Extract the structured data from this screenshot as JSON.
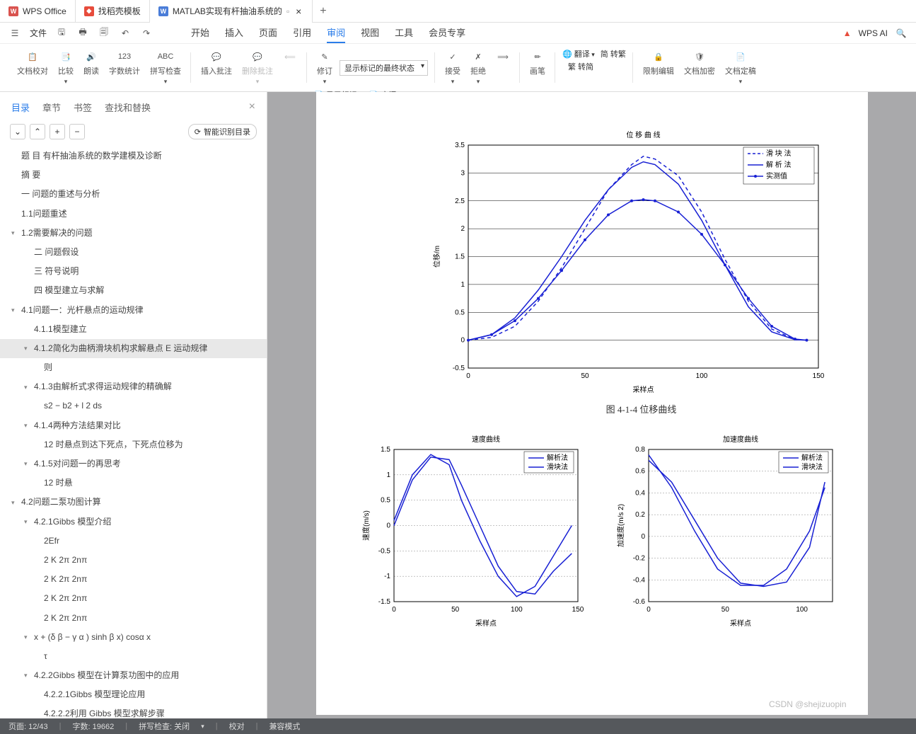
{
  "titlebar": {
    "tabs": [
      {
        "label": "WPS Office",
        "logo_bg": "#d9534f",
        "logo_text": "W"
      },
      {
        "label": "找稻壳模板",
        "logo_bg": "#e74c3c",
        "logo_text": "◆"
      },
      {
        "label": "MATLAB实现有杆抽油系统的",
        "logo_bg": "#4a7dd8",
        "logo_text": "W",
        "active": true,
        "suffix_icon": "▫"
      }
    ]
  },
  "menubar": {
    "file_label": "文件",
    "tabs": [
      "开始",
      "插入",
      "页面",
      "引用",
      "审阅",
      "视图",
      "工具",
      "会员专享"
    ],
    "active_tab": "审阅",
    "wps_ai": "WPS AI"
  },
  "ribbon": {
    "g1": {
      "b1": "文档校对",
      "b2": "比较",
      "b3": "朗读",
      "b4": "字数统计",
      "b5": "拼写检查"
    },
    "g2": {
      "b1": "插入批注",
      "b2": "删除批注"
    },
    "g3": {
      "b1": "修订",
      "sel": "显示标记的最终状态",
      "b2": "显示标记",
      "b3": "审阅"
    },
    "g4": {
      "b1": "接受",
      "b2": "拒绝"
    },
    "g5": {
      "b1": "画笔"
    },
    "g6": {
      "b1": "翻译",
      "b2": "简  转繁",
      "b3": "繁  转简"
    },
    "g7": {
      "b1": "限制编辑",
      "b2": "文档加密",
      "b3": "文档定稿"
    }
  },
  "sidebar": {
    "tabs": [
      "目录",
      "章节",
      "书签",
      "查找和替换"
    ],
    "active": "目录",
    "ai_btn": "智能识别目录",
    "toc": [
      {
        "lvl": 0,
        "txt": "题 目 有杆抽油系统的数学建模及诊断"
      },
      {
        "lvl": 0,
        "txt": "摘 要"
      },
      {
        "lvl": 0,
        "txt": "一 问题的重述与分析"
      },
      {
        "lvl": 0,
        "txt": "1.1问题重述"
      },
      {
        "lvl": 0,
        "txt": "1.2需要解决的问题",
        "caret": "▾"
      },
      {
        "lvl": 2,
        "txt": "二 问题假设"
      },
      {
        "lvl": 2,
        "txt": "三 符号说明"
      },
      {
        "lvl": 2,
        "txt": "四 模型建立与求解"
      },
      {
        "lvl": 0,
        "txt": "4.1问题一：光杆悬点的运动规律",
        "caret": "▾"
      },
      {
        "lvl": 2,
        "txt": "4.1.1模型建立"
      },
      {
        "lvl": 2,
        "txt": "4.1.2简化为曲柄滑块机构求解悬点 E 运动规律",
        "caret": "▾",
        "sel": true
      },
      {
        "lvl": 3,
        "txt": "则"
      },
      {
        "lvl": 2,
        "txt": "4.1.3由解析式求得运动规律的精确解",
        "caret": "▾"
      },
      {
        "lvl": 3,
        "txt": "s2 − b2 + l 2 ds"
      },
      {
        "lvl": 2,
        "txt": "4.1.4两种方法结果对比",
        "caret": "▾"
      },
      {
        "lvl": 3,
        "txt": "12 时悬点到达下死点，下死点位移为"
      },
      {
        "lvl": 2,
        "txt": "4.1.5对问题一的再思考",
        "caret": "▾"
      },
      {
        "lvl": 3,
        "txt": "12 时悬"
      },
      {
        "lvl": 0,
        "txt": "4.2问题二泵功图计算",
        "caret": "▾"
      },
      {
        "lvl": 2,
        "txt": "4.2.1Gibbs 模型介绍",
        "caret": "▾"
      },
      {
        "lvl": 3,
        "txt": "2Efr"
      },
      {
        "lvl": 3,
        "txt": "2  K  2π  2nπ"
      },
      {
        "lvl": 3,
        "txt": "2  K  2π  2nπ"
      },
      {
        "lvl": 3,
        "txt": "2  K  2π  2nπ"
      },
      {
        "lvl": 3,
        "txt": "2  K  2π  2nπ"
      },
      {
        "lvl": 2,
        "txt": "x + (δ β − γ α )  sinh β x)  cosα x",
        "caret": "▾"
      },
      {
        "lvl": 3,
        "txt": "τ"
      },
      {
        "lvl": 2,
        "txt": "4.2.2Gibbs 模型在计算泵功图中的应用",
        "caret": "▾"
      },
      {
        "lvl": 3,
        "txt": "4.2.2.1Gibbs 模型理论应用"
      },
      {
        "lvl": 3,
        "txt": "4.2.2.2利用 Gibbs 模型求解步骤"
      }
    ]
  },
  "document": {
    "fig_caption": "图 4-1-4    位移曲线",
    "watermark": "CSDN @shejizuopin"
  },
  "chart_data": [
    {
      "type": "line",
      "title": "位 移 曲 线",
      "xlabel": "采样点",
      "ylabel": "位移/m",
      "xlim": [
        0,
        150
      ],
      "ylim": [
        -0.5,
        3.5
      ],
      "xticks": [
        0,
        50,
        100,
        150
      ],
      "yticks": [
        -0.5,
        0,
        0.5,
        1,
        1.5,
        2,
        2.5,
        3,
        3.5
      ],
      "series": [
        {
          "name": "滑 块 法",
          "style": "dashed",
          "color": "#1820d4",
          "x": [
            0,
            10,
            20,
            30,
            40,
            50,
            60,
            70,
            75,
            80,
            90,
            100,
            110,
            120,
            130,
            140,
            145
          ],
          "y": [
            0,
            0.05,
            0.25,
            0.7,
            1.3,
            2.0,
            2.7,
            3.15,
            3.3,
            3.25,
            2.95,
            2.3,
            1.45,
            0.7,
            0.2,
            0.01,
            0
          ]
        },
        {
          "name": "解 析 法",
          "style": "solid",
          "color": "#1820d4",
          "x": [
            0,
            10,
            20,
            30,
            40,
            50,
            60,
            70,
            75,
            80,
            90,
            100,
            110,
            120,
            130,
            140,
            145
          ],
          "y": [
            0,
            0.1,
            0.4,
            0.9,
            1.5,
            2.15,
            2.7,
            3.1,
            3.2,
            3.15,
            2.8,
            2.15,
            1.35,
            0.6,
            0.15,
            0.01,
            0
          ]
        },
        {
          "name": "实测值",
          "style": "points",
          "color": "#1820d4",
          "x": [
            0,
            10,
            20,
            30,
            40,
            50,
            60,
            70,
            75,
            80,
            90,
            100,
            110,
            120,
            130,
            140,
            145
          ],
          "y": [
            0,
            0.1,
            0.35,
            0.75,
            1.25,
            1.8,
            2.25,
            2.5,
            2.52,
            2.5,
            2.3,
            1.9,
            1.35,
            0.75,
            0.25,
            0.02,
            0
          ]
        }
      ]
    },
    {
      "type": "line",
      "title": "速度曲线",
      "xlabel": "采样点",
      "ylabel": "速度(m/s)",
      "xlim": [
        0,
        150
      ],
      "ylim": [
        -1.5,
        1.5
      ],
      "xticks": [
        0,
        50,
        100,
        150
      ],
      "yticks": [
        -1.5,
        -1,
        -0.5,
        0,
        0.5,
        1,
        1.5
      ],
      "series": [
        {
          "name": "解析法",
          "style": "solid",
          "color": "#1820d4",
          "x": [
            0,
            15,
            30,
            45,
            55,
            70,
            85,
            100,
            115,
            130,
            145
          ],
          "y": [
            0,
            0.9,
            1.35,
            1.3,
            0.8,
            0,
            -0.8,
            -1.3,
            -1.35,
            -0.9,
            -0.55
          ]
        },
        {
          "name": "滑块法",
          "style": "solid",
          "color": "#1820d4",
          "x": [
            0,
            15,
            30,
            45,
            55,
            70,
            85,
            100,
            115,
            130,
            145
          ],
          "y": [
            0.1,
            1.0,
            1.4,
            1.2,
            0.5,
            -0.3,
            -1.0,
            -1.4,
            -1.2,
            -0.6,
            0
          ]
        }
      ]
    },
    {
      "type": "line",
      "title": "加速度曲线",
      "xlabel": "采样点",
      "ylabel": "加速度(m/s 2)",
      "xlim": [
        0,
        120
      ],
      "ylim": [
        -0.6,
        0.8
      ],
      "xticks": [
        0,
        50,
        100
      ],
      "yticks": [
        -0.6,
        -0.4,
        -0.2,
        0,
        0.2,
        0.4,
        0.6,
        0.8
      ],
      "series": [
        {
          "name": "解析法",
          "style": "solid",
          "color": "#1820d4",
          "x": [
            0,
            15,
            30,
            45,
            60,
            75,
            90,
            105,
            115
          ],
          "y": [
            0.75,
            0.45,
            0.05,
            -0.3,
            -0.45,
            -0.45,
            -0.3,
            0.05,
            0.45
          ]
        },
        {
          "name": "滑块法",
          "style": "solid",
          "color": "#1820d4",
          "x": [
            0,
            15,
            30,
            45,
            60,
            75,
            90,
            105,
            115
          ],
          "y": [
            0.7,
            0.5,
            0.15,
            -0.2,
            -0.43,
            -0.46,
            -0.42,
            -0.1,
            0.5
          ]
        }
      ]
    }
  ],
  "statusbar": {
    "page": "页面: 12/43",
    "words": "字数: 19662",
    "spell": "拼写检查: 关闭",
    "proof": "校对",
    "compat": "兼容模式"
  }
}
